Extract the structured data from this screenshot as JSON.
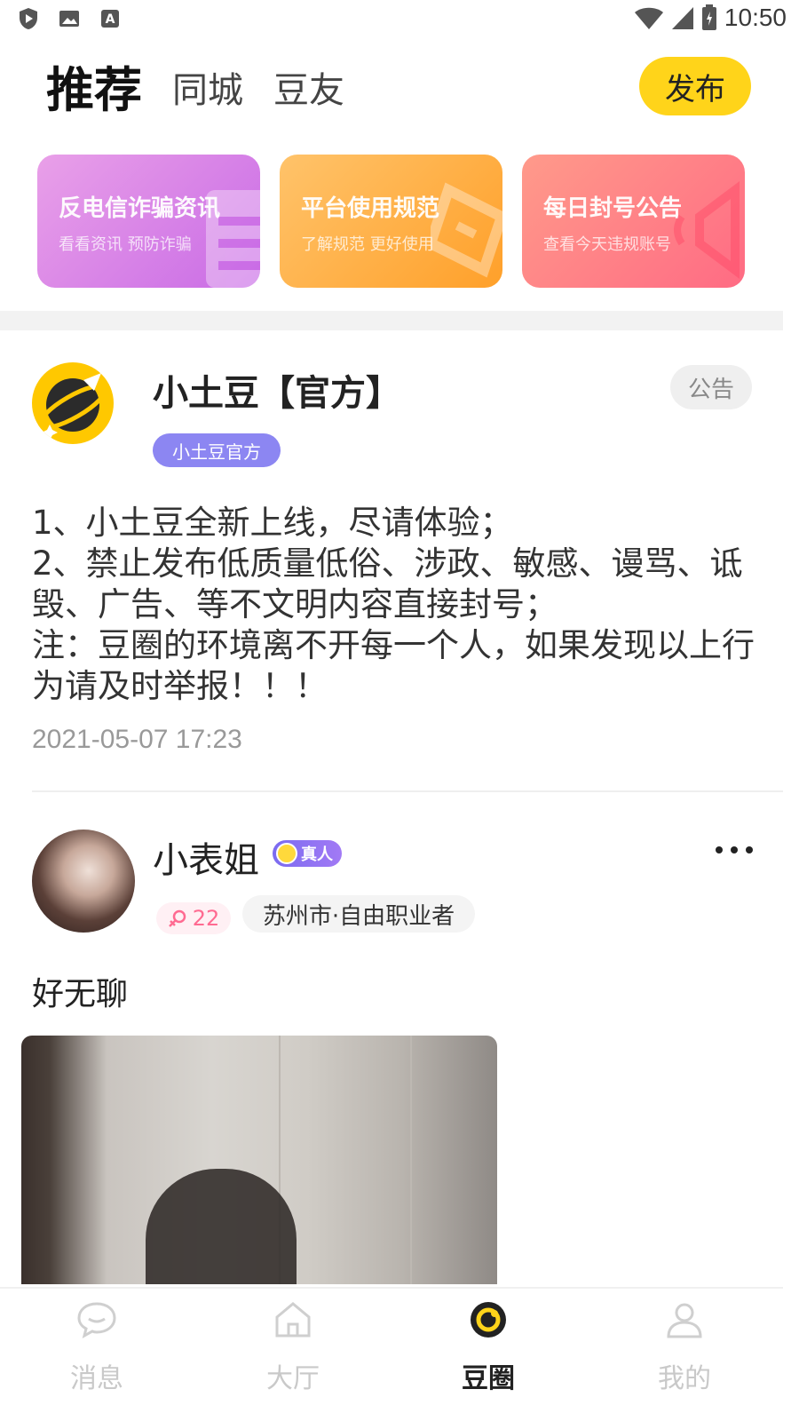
{
  "status_bar": {
    "time": "10:50"
  },
  "top_tabs": [
    {
      "label": "推荐"
    },
    {
      "label": "同城"
    },
    {
      "label": "豆友"
    }
  ],
  "publish_label": "发布",
  "banners": [
    {
      "title": "反电信诈骗资讯",
      "subtitle": "看看资讯 预防诈骗"
    },
    {
      "title": "平台使用规范",
      "subtitle": "了解规范 更好使用"
    },
    {
      "title": "每日封号公告",
      "subtitle": "查看今天违规账号"
    }
  ],
  "post_official": {
    "author": "小土豆【官方】",
    "badge": "公告",
    "tag": "小土豆官方",
    "lines": [
      "1、小土豆全新上线，尽请体验；",
      "2、禁止发布低质量低俗、涉政、敏感、谩骂、诋",
      "毁、广告、等不文明内容直接封号；",
      "注：豆圈的环境离不开每一个人，如果发现以上行",
      "为请及时举报！！！"
    ],
    "time": "2021-05-07 17:23"
  },
  "post_user": {
    "author": "小表姐",
    "verified_label": "真人",
    "age": "22",
    "location": "苏州市·自由职业者",
    "text": "好无聊"
  },
  "bottom_nav": [
    {
      "label": "消息"
    },
    {
      "label": "大厅"
    },
    {
      "label": "豆圈"
    },
    {
      "label": "我的"
    }
  ],
  "colors": {
    "accent_yellow": "#ffd41a",
    "official_tag": "#8c86f2",
    "female_pink": "#ff6a91"
  }
}
